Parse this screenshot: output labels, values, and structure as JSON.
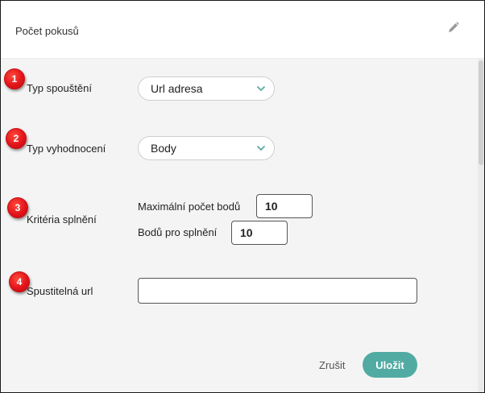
{
  "header": {
    "title": "Počet pokusů",
    "edit_icon": "pencil-icon"
  },
  "markers": [
    "1",
    "2",
    "3",
    "4"
  ],
  "form": {
    "launch_type": {
      "label": "Typ spouštění",
      "value": "Url adresa"
    },
    "evaluation_type": {
      "label": "Typ vyhodnocení",
      "value": "Body"
    },
    "criteria": {
      "label": "Kritéria splnění",
      "max_points_label": "Maximální počet bodů",
      "max_points_value": "10",
      "pass_points_label": "Bodů pro splnění",
      "pass_points_value": "10"
    },
    "url": {
      "label": "Spustitelná url",
      "value": ""
    }
  },
  "actions": {
    "cancel": "Zrušit",
    "save": "Uložit"
  },
  "colors": {
    "accent": "#52aba3",
    "marker": "#e4141a",
    "background": "#f4f4f4"
  }
}
